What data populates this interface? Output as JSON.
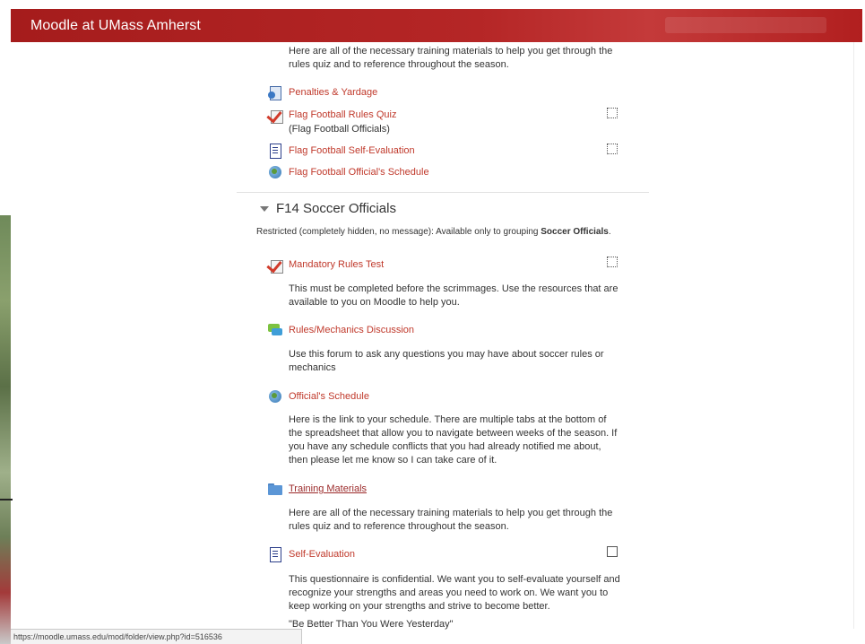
{
  "header": {
    "brand": "Moodle at UMass Amherst"
  },
  "section_prev": {
    "intro": "Here are all of the necessary training materials to help you get through the rules quiz and to reference throughout the season.",
    "activities": [
      {
        "label": "Penalties & Yardage",
        "icon": "page-icon"
      },
      {
        "label": "Flag Football Rules Quiz",
        "icon": "quiz-icon",
        "sublabel": "(Flag Football Officials)"
      },
      {
        "label": "Flag Football Self-Evaluation",
        "icon": "feedback-icon"
      },
      {
        "label": "Flag Football Official's Schedule",
        "icon": "url-icon"
      }
    ]
  },
  "section": {
    "title": "F14 Soccer Officials",
    "restriction_text": "Restricted (completely hidden, no message): Available only to grouping",
    "restriction_group": "Soccer Officials",
    "restriction_end": ".",
    "activities": [
      {
        "label": "Mandatory Rules Test",
        "icon": "quiz-icon",
        "desc": "This must be completed before the scrimmages. Use the resources that are available to you on Moodle to help you."
      },
      {
        "label": "Rules/Mechanics Discussion",
        "icon": "forum-icon",
        "desc": "Use this forum to ask any questions you may have about soccer rules or mechanics"
      },
      {
        "label": "Official's Schedule",
        "icon": "url-icon",
        "desc": "Here is the link to your schedule. There are multiple tabs at the bottom of the spreadsheet that allow you to navigate between weeks of the season. If you have any schedule conflicts that you had already notified me about, then please let me know so I can take care of it."
      },
      {
        "label": "Training Materials",
        "icon": "folder-icon",
        "desc": "Here are all of the necessary training materials to help you get through the rules quiz and to reference throughout the season."
      },
      {
        "label": "Self-Evaluation",
        "icon": "feedback-icon",
        "desc": "This questionnaire is confidential. We want you to self-evaluate yourself and recognize your strengths and areas you need to work on. We want you to keep working on your strengths and strive to become better.",
        "quote": "\"Be Better Than You Were Yesterday\""
      }
    ]
  },
  "statusbar": {
    "url": "https://moodle.umass.edu/mod/folder/view.php?id=516536"
  },
  "colors": {
    "header": "#b52626",
    "link": "#c0392b"
  }
}
